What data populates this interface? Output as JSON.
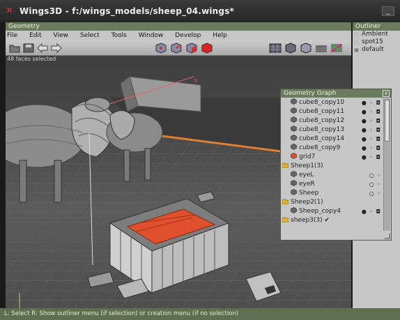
{
  "window": {
    "title": "Wings3D - f:/wings_models/sheep_04.wings*",
    "minimize": "_"
  },
  "geometry": {
    "panel_title": "Geometry",
    "menu": [
      "File",
      "Edit",
      "View",
      "Select",
      "Tools",
      "Window",
      "Develop",
      "Help"
    ],
    "status_selected": "48 faces selected",
    "axis_label": "x"
  },
  "outliner": {
    "panel_title": "Outliner",
    "items": [
      {
        "label": "Ambient",
        "icon": "light-bulb-icon"
      },
      {
        "label": "spot15",
        "icon": "light-bulb-icon"
      },
      {
        "label": "default",
        "icon": "material-icon"
      }
    ]
  },
  "graph": {
    "title": "Geometry Graph",
    "close": "x",
    "rows": [
      {
        "label": "cube8_copy10",
        "indent": 1,
        "type": "object",
        "vis": "● ◦ ◘"
      },
      {
        "label": "cube8_copy11",
        "indent": 1,
        "type": "object",
        "vis": "● ◦ ◘"
      },
      {
        "label": "cube8_copy12",
        "indent": 1,
        "type": "object",
        "vis": "● ◦ ◘"
      },
      {
        "label": "cube8_copy13",
        "indent": 1,
        "type": "object",
        "vis": "● ◦ ◘"
      },
      {
        "label": "cube8_copy14",
        "indent": 1,
        "type": "object",
        "vis": "● ◦ ◘"
      },
      {
        "label": "cube8_copy9",
        "indent": 1,
        "type": "object",
        "vis": "● ◦ ◘"
      },
      {
        "label": "grid7",
        "indent": 1,
        "type": "selected-object",
        "vis": "● ◦ ◘"
      },
      {
        "label": "Sheep1(3)",
        "indent": 0,
        "type": "folder",
        "vis": ""
      },
      {
        "label": "eyeL",
        "indent": 1,
        "type": "object",
        "vis": "○ ◦"
      },
      {
        "label": "eyeR",
        "indent": 1,
        "type": "object",
        "vis": "○ ◦"
      },
      {
        "label": "Sheep",
        "indent": 1,
        "type": "object",
        "vis": "○ ◦"
      },
      {
        "label": "Sheep2(1)",
        "indent": 0,
        "type": "folder",
        "vis": ""
      },
      {
        "label": "Sheep_copy4",
        "indent": 1,
        "type": "object",
        "vis": "● ◦ ◘"
      },
      {
        "label": "sheep3(3) ✔",
        "indent": 0,
        "type": "folder",
        "vis": ""
      }
    ]
  },
  "statusbar": {
    "text": "L: Select  R: Show outliner menu (if selection) or creation menu (if no selection)"
  },
  "colors": {
    "panel_title": "#6b7c5c",
    "selection": "#e0502e",
    "folder": "#e0b030"
  }
}
